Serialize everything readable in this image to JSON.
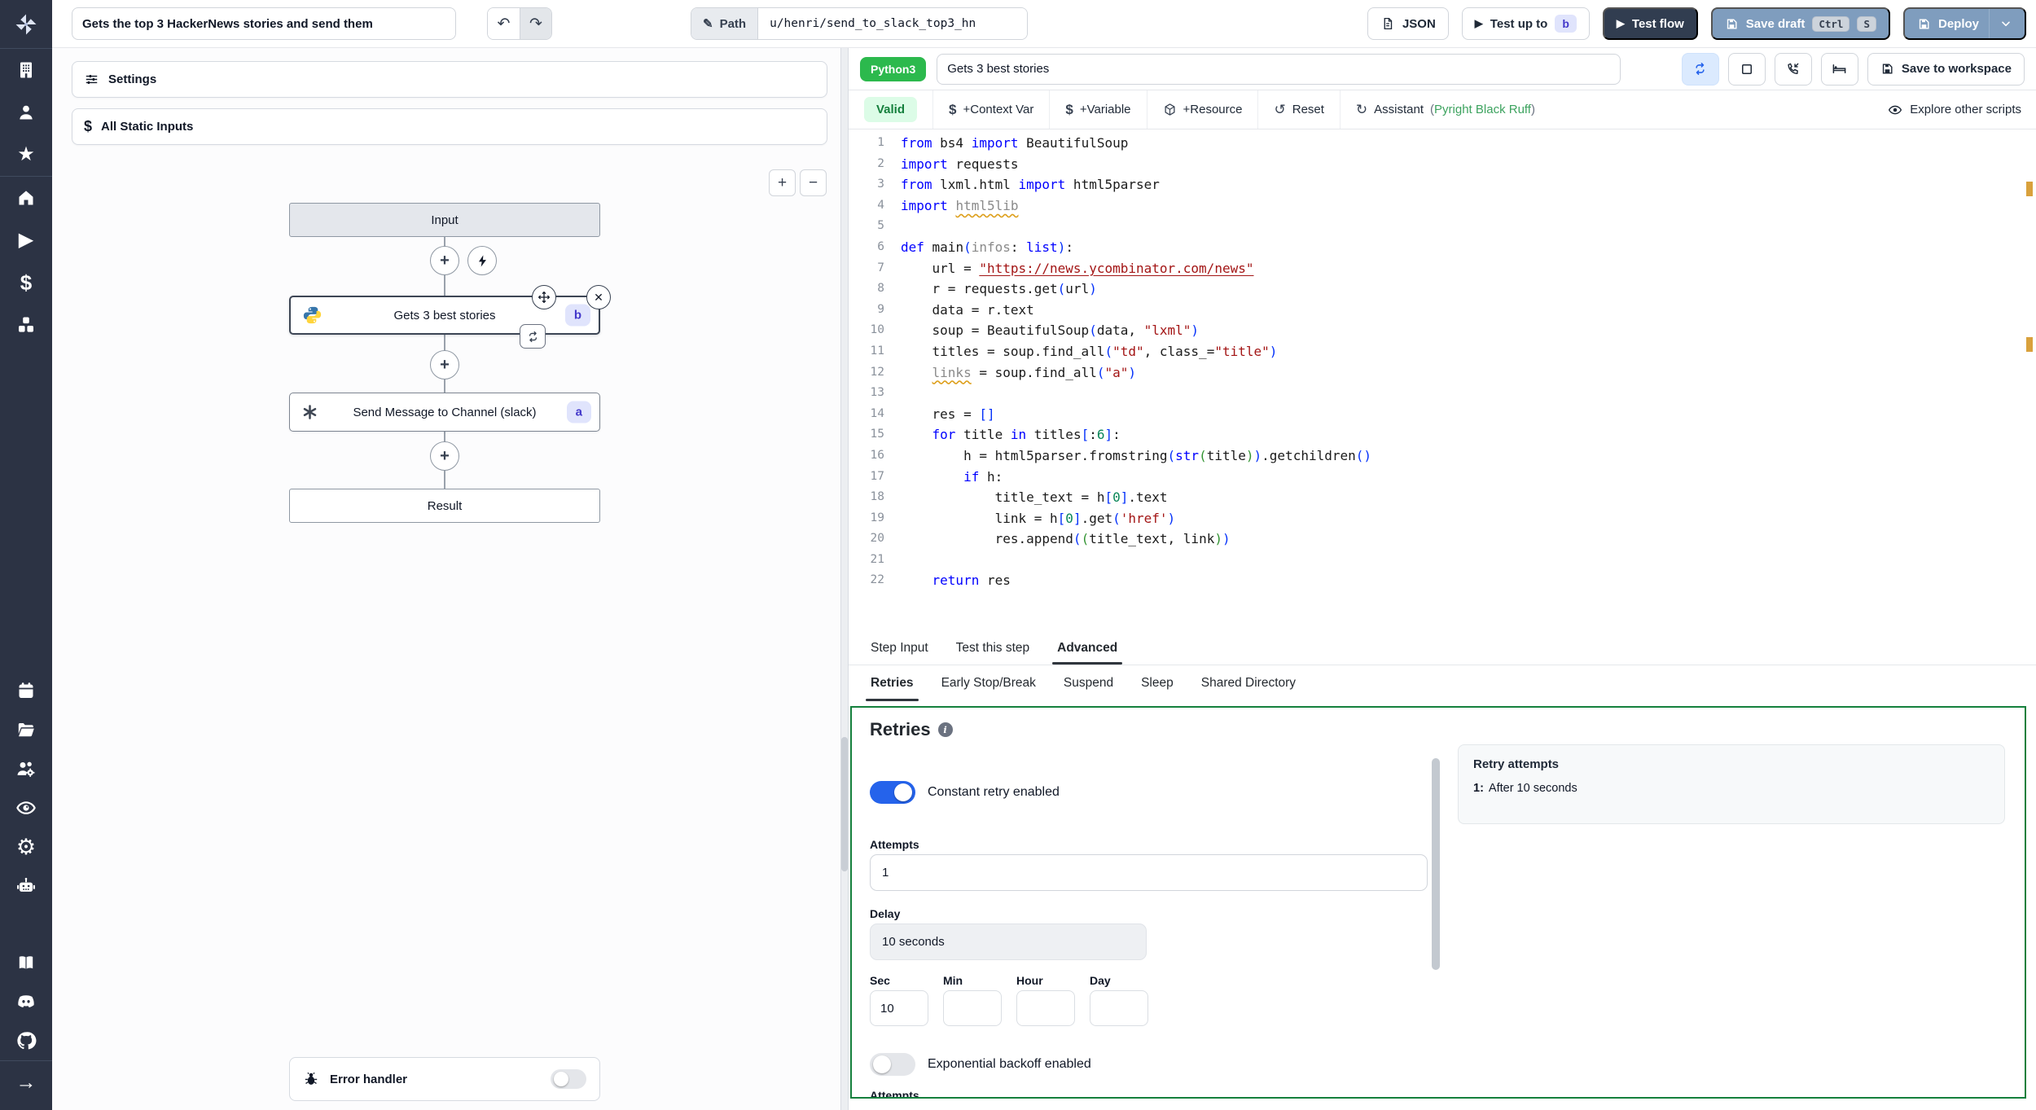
{
  "icons": {
    "undo": "↶",
    "redo": "↷",
    "pencil": "✎",
    "play": "▶",
    "star": "★",
    "dollar": "$",
    "gear": "⚙",
    "arrow_right": "→",
    "plus": "+",
    "minus": "−",
    "close": "✕",
    "info": "i"
  },
  "sidebar": {
    "icon_names": [
      "windmill-logo",
      "workspace-building",
      "user",
      "favorites-star",
      "home",
      "runs-play",
      "variables-dollar",
      "resources-cubes",
      "schedules-calendar",
      "folders",
      "groups",
      "audit-eye",
      "settings-gear",
      "ai-robot",
      "docs-book",
      "discord",
      "github",
      "collapse-arrow"
    ]
  },
  "topbar": {
    "flow_title": "Gets the top 3 HackerNews stories and send them",
    "path_label": "Path",
    "path_value": "u/henri/send_to_slack_top3_hn",
    "json_label": "JSON",
    "test_up_to_label": "Test up to",
    "test_up_to_badge": "b",
    "test_flow_label": "Test flow",
    "save_draft_label": "Save draft",
    "save_draft_kbd": [
      "Ctrl",
      "S"
    ],
    "deploy_label": "Deploy"
  },
  "flow": {
    "settings_label": "Settings",
    "static_inputs_label": "All Static Inputs",
    "nodes": {
      "input_label": "Input",
      "step_b_label": "Gets 3 best stories",
      "step_b_badge": "b",
      "step_a_label": "Send Message to Channel (slack)",
      "step_a_badge": "a",
      "result_label": "Result"
    },
    "error_handler_label": "Error handler"
  },
  "editor": {
    "language_badge": "Python3",
    "step_title": "Gets 3 best stories",
    "save_to_workspace_label": "Save to workspace",
    "toolbar": {
      "valid_label": "Valid",
      "context_var_label": "+Context Var",
      "variable_label": "+Variable",
      "resource_label": "+Resource",
      "reset_label": "Reset",
      "reset_icon": "↺",
      "assistant_icon": "↻",
      "assistant_label": "Assistant",
      "assistant_paren_open": "(",
      "assistant_tools": "Pyright Black Ruff",
      "assistant_paren_close": ")",
      "explore_label": "Explore other scripts"
    },
    "lines": [
      [
        [
          "k",
          "from"
        ],
        [
          "p",
          " bs4 "
        ],
        [
          "k",
          "import"
        ],
        [
          "p",
          " BeautifulSoup"
        ]
      ],
      [
        [
          "k",
          "import"
        ],
        [
          "p",
          " requests"
        ]
      ],
      [
        [
          "k",
          "from"
        ],
        [
          "p",
          " lxml.html "
        ],
        [
          "k",
          "import"
        ],
        [
          "p",
          " html5parser"
        ]
      ],
      [
        [
          "k",
          "import"
        ],
        [
          "p",
          " "
        ],
        [
          "dw",
          "html5lib"
        ]
      ],
      [],
      [
        [
          "k",
          "def"
        ],
        [
          "p",
          " main"
        ],
        [
          "b1",
          "("
        ],
        [
          "dim",
          "infos"
        ],
        [
          "p",
          ": "
        ],
        [
          "k",
          "list"
        ],
        [
          "b1",
          ")"
        ],
        [
          "p",
          ":"
        ]
      ],
      [
        [
          "p",
          "    url = "
        ],
        [
          "sl",
          "\"https://news.ycombinator.com/news\""
        ]
      ],
      [
        [
          "p",
          "    r = requests.get"
        ],
        [
          "b1",
          "("
        ],
        [
          "p",
          "url"
        ],
        [
          "b1",
          ")"
        ]
      ],
      [
        [
          "p",
          "    data = r.text"
        ]
      ],
      [
        [
          "p",
          "    soup = BeautifulSoup"
        ],
        [
          "b1",
          "("
        ],
        [
          "p",
          "data, "
        ],
        [
          "s",
          "\"lxml\""
        ],
        [
          "b1",
          ")"
        ]
      ],
      [
        [
          "p",
          "    titles = soup.find_all"
        ],
        [
          "b1",
          "("
        ],
        [
          "s",
          "\"td\""
        ],
        [
          "p",
          ", class_="
        ],
        [
          "s",
          "\"title\""
        ],
        [
          "b1",
          ")"
        ]
      ],
      [
        [
          "p",
          "    "
        ],
        [
          "dw",
          "links"
        ],
        [
          "p",
          " = soup.find_all"
        ],
        [
          "b1",
          "("
        ],
        [
          "s",
          "\"a\""
        ],
        [
          "b1",
          ")"
        ]
      ],
      [],
      [
        [
          "p",
          "    res = "
        ],
        [
          "b1",
          "[]"
        ]
      ],
      [
        [
          "p",
          "    "
        ],
        [
          "k",
          "for"
        ],
        [
          "p",
          " title "
        ],
        [
          "k",
          "in"
        ],
        [
          "p",
          " titles"
        ],
        [
          "b1",
          "["
        ],
        [
          "p",
          ":"
        ],
        [
          "n",
          "6"
        ],
        [
          "b1",
          "]"
        ],
        [
          "p",
          ":"
        ]
      ],
      [
        [
          "p",
          "        h = html5parser.fromstring"
        ],
        [
          "b1",
          "("
        ],
        [
          "k",
          "str"
        ],
        [
          "b2",
          "("
        ],
        [
          "p",
          "title"
        ],
        [
          "b2",
          ")"
        ],
        [
          "b1",
          ")"
        ],
        [
          "p",
          ".getchildren"
        ],
        [
          "b1",
          "()"
        ]
      ],
      [
        [
          "p",
          "        "
        ],
        [
          "k",
          "if"
        ],
        [
          "p",
          " h:"
        ]
      ],
      [
        [
          "p",
          "            title_text = h"
        ],
        [
          "b1",
          "["
        ],
        [
          "n",
          "0"
        ],
        [
          "b1",
          "]"
        ],
        [
          "p",
          ".text"
        ]
      ],
      [
        [
          "p",
          "            link = h"
        ],
        [
          "b1",
          "["
        ],
        [
          "n",
          "0"
        ],
        [
          "b1",
          "]"
        ],
        [
          "p",
          ".get"
        ],
        [
          "b1",
          "("
        ],
        [
          "s",
          "'href'"
        ],
        [
          "b1",
          ")"
        ]
      ],
      [
        [
          "p",
          "            res.append"
        ],
        [
          "b1",
          "("
        ],
        [
          "b2",
          "("
        ],
        [
          "p",
          "title_text, link"
        ],
        [
          "b2",
          ")"
        ],
        [
          "b1",
          ")"
        ]
      ],
      [],
      [
        [
          "p",
          "    "
        ],
        [
          "k",
          "return"
        ],
        [
          "p",
          " res"
        ]
      ]
    ]
  },
  "tabs": {
    "step_tabs": [
      {
        "label": "Step Input"
      },
      {
        "label": "Test this step"
      },
      {
        "label": "Advanced"
      }
    ],
    "advanced_tabs": [
      {
        "label": "Retries"
      },
      {
        "label": "Early Stop/Break"
      },
      {
        "label": "Suspend"
      },
      {
        "label": "Sleep"
      },
      {
        "label": "Shared Directory"
      }
    ]
  },
  "retries": {
    "heading": "Retries",
    "constant_toggle_label": "Constant retry enabled",
    "attempts_label": "Attempts",
    "attempts_value": "1",
    "delay_label": "Delay",
    "delay_value": "10 seconds",
    "time_fields": [
      {
        "label": "Sec",
        "value": "10"
      },
      {
        "label": "Min",
        "value": ""
      },
      {
        "label": "Hour",
        "value": ""
      },
      {
        "label": "Day",
        "value": ""
      }
    ],
    "exponential_toggle_label": "Exponential backoff enabled",
    "attempts2_label": "Attempts",
    "summary": {
      "title": "Retry attempts",
      "item_index": "1:",
      "item_text": "After 10 seconds"
    }
  }
}
